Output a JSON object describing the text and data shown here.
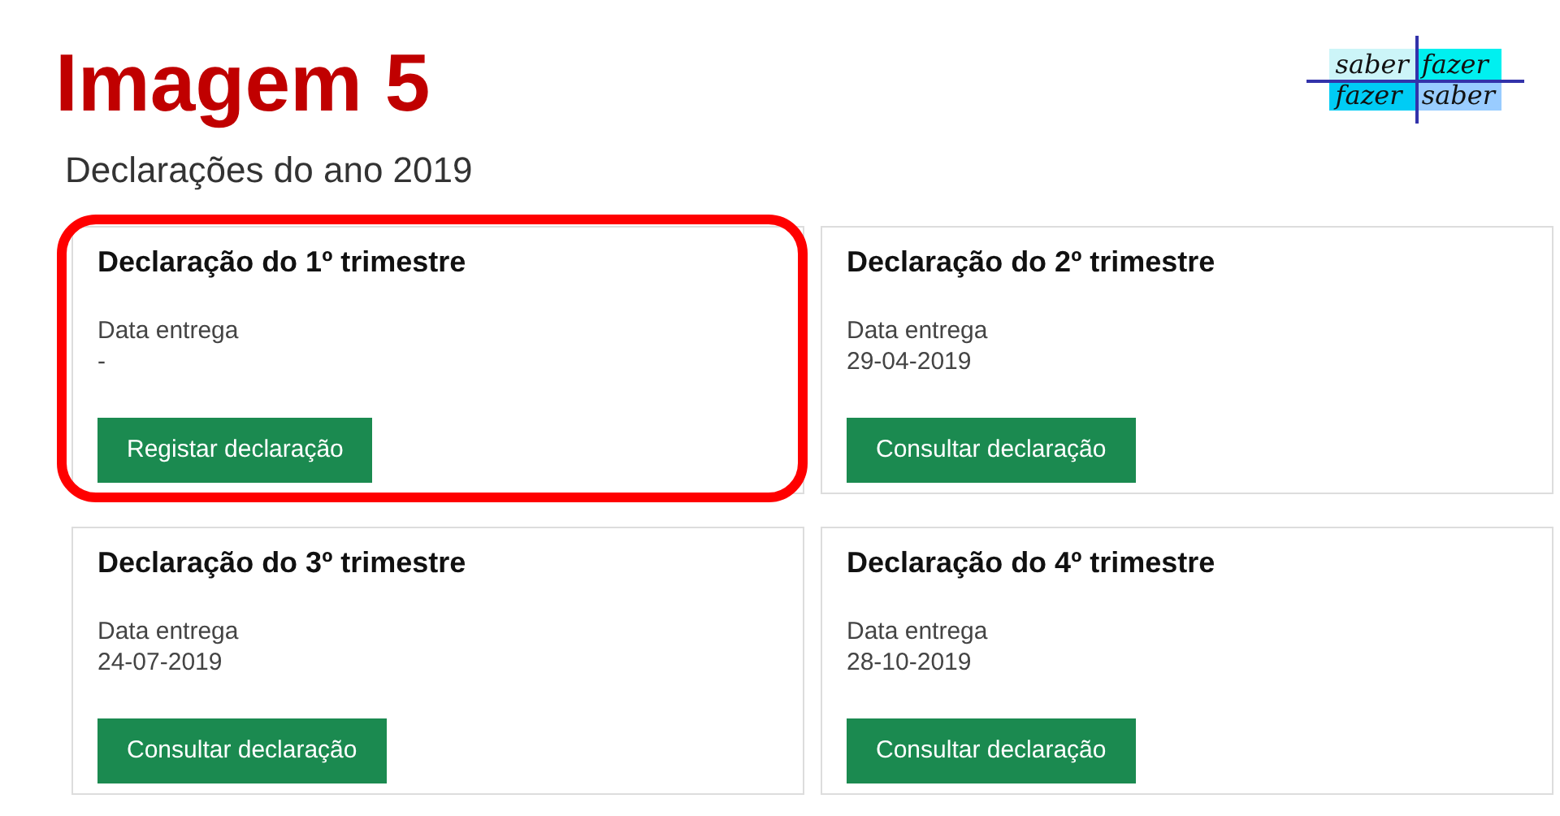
{
  "heading": "Imagem 5",
  "logo": {
    "cells": [
      {
        "text": "saber",
        "color": "#ccf5f8"
      },
      {
        "text": "fazer",
        "color": "#00f0f0"
      },
      {
        "text": "fazer",
        "color": "#00ccf5"
      },
      {
        "text": "saber",
        "color": "#99ccff"
      }
    ]
  },
  "subtitle": "Declarações do ano 2019",
  "cards": [
    {
      "title": "Declaração do 1º trimestre",
      "label": "Data entrega",
      "date": "-",
      "button": "Registar declaração",
      "highlighted": true
    },
    {
      "title": "Declaração do 2º trimestre",
      "label": "Data entrega",
      "date": "29-04-2019",
      "button": "Consultar declaração",
      "highlighted": false
    },
    {
      "title": "Declaração do 3º trimestre",
      "label": "Data entrega",
      "date": "24-07-2019",
      "button": "Consultar declaração",
      "highlighted": false
    },
    {
      "title": "Declaração do 4º trimestre",
      "label": "Data entrega",
      "date": "28-10-2019",
      "button": "Consultar declaração",
      "highlighted": false
    }
  ]
}
